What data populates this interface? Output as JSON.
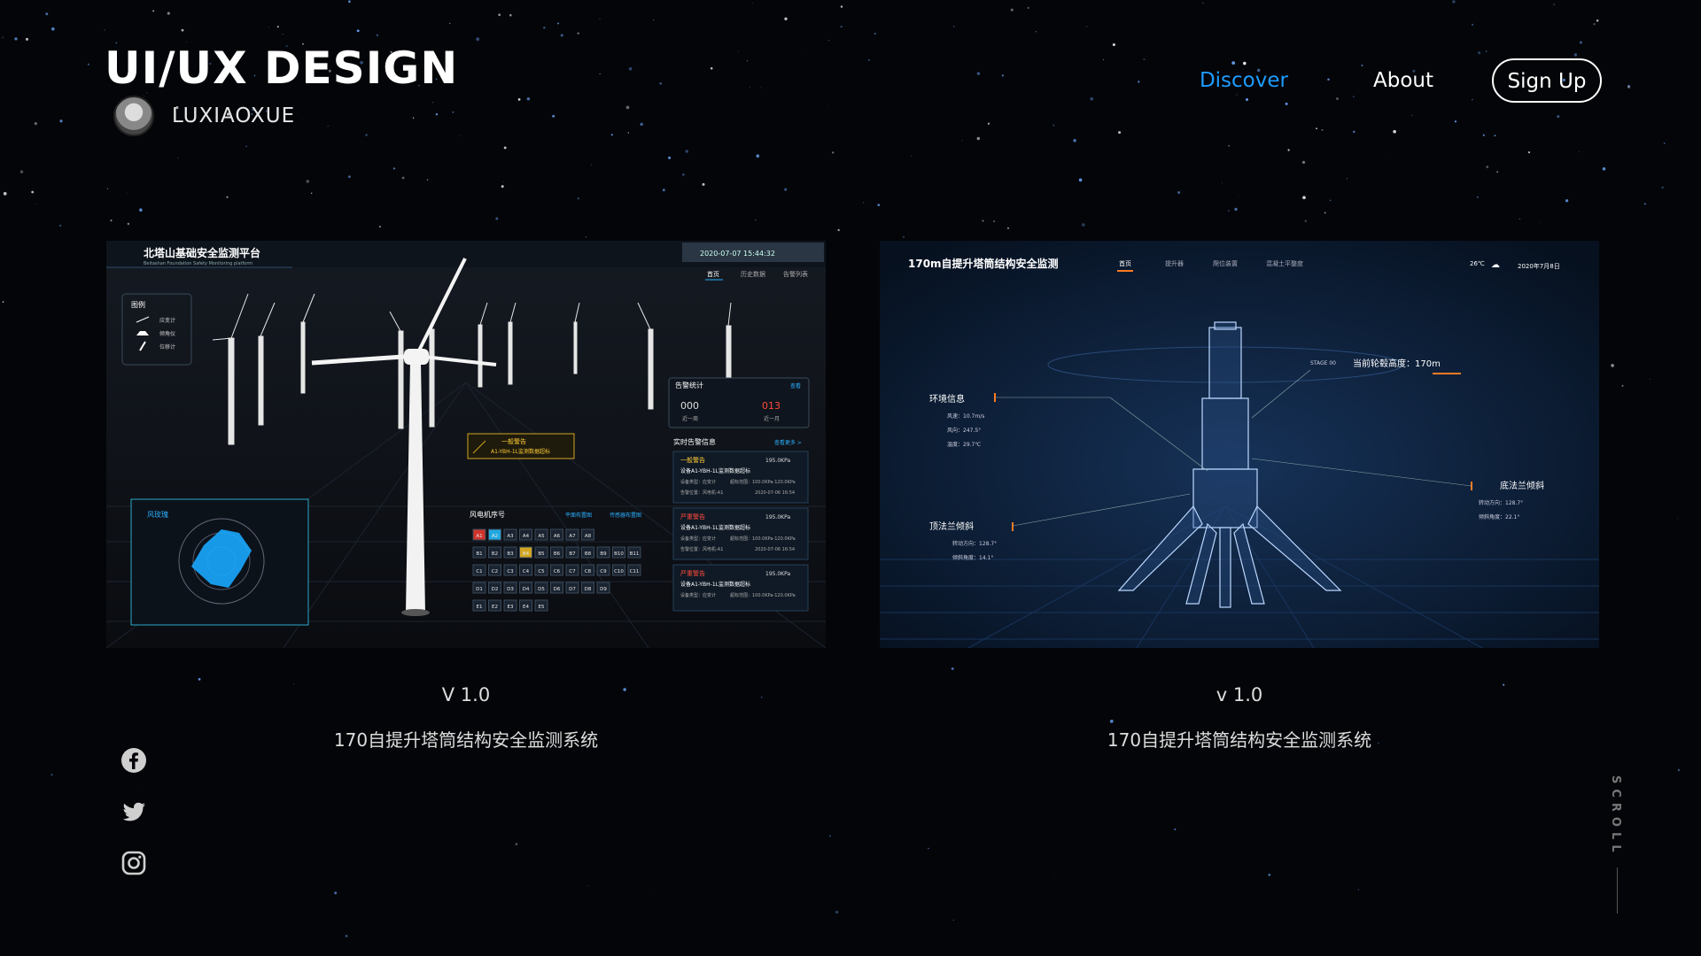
{
  "header": {
    "title": "UI/UX DESIGN",
    "author": "LUXIAOXUE"
  },
  "nav": {
    "discover": "Discover",
    "about": "About",
    "signup": "Sign Up",
    "active_color": "#1e9cff"
  },
  "projects": [
    {
      "version": "V 1.0",
      "name": "170自提升塔筒结构安全监测系统",
      "screen": {
        "title": "北塔山基础安全监测平台",
        "subtitle": "Beitashan Foundation Safety Monitoring platform",
        "datetime": "2020-07-07   15:44:32",
        "tabs": [
          "首页",
          "历史数据",
          "告警列表"
        ],
        "legend_title": "图例",
        "legend_items": [
          "应变计",
          "倾角仪",
          "位移计"
        ],
        "alarm_stats_title": "告警统计",
        "alarm_stats_link": "查看",
        "alarm_week_value": "000",
        "alarm_week_label": "近一周",
        "alarm_month_value": "013",
        "alarm_month_label": "近一月",
        "realtime_title": "实时告警信息",
        "realtime_link": "查看更多 >",
        "callout_title": "一般警告",
        "callout_text": "A1-YBH-1L监测数据超标",
        "alarms": [
          {
            "level": "一般警告",
            "value": "195.0KPa",
            "desc": "设备A1-YBH-1L监测数据超标",
            "type": "设备类型：应变计",
            "range": "超标范围：100.0KPa-120.0KPa",
            "pos": "告警位置：风电机-A1",
            "time": "2020-07-06 16:54"
          },
          {
            "level": "严重警告",
            "value": "195.0KPa",
            "desc": "设备A1-YBH-1L监测数据超标",
            "type": "设备类型：应变计",
            "range": "超标范围：100.0KPa-120.0KPa",
            "pos": "告警位置：风电机-A1",
            "time": "2020-07-06 16:54"
          },
          {
            "level": "严重警告",
            "value": "195.0KPa",
            "desc": "设备A1-YBH-1L监测数据超标",
            "type": "设备类型：应变计",
            "range": "超标范围：100.0KPa-120.0KPa"
          }
        ],
        "wind_rose_title": "风玫瑰",
        "turbine_title": "风电机序号",
        "turbine_link1": "平面布置图",
        "turbine_link2": "传感器布置图",
        "turbine_rows": [
          [
            "A1",
            "A2",
            "A3",
            "A4",
            "A5",
            "A6",
            "A7",
            "A8"
          ],
          [
            "B1",
            "B2",
            "B3",
            "B4",
            "B5",
            "B6",
            "B7",
            "B8",
            "B9",
            "B10",
            "B11"
          ],
          [
            "C1",
            "C2",
            "C3",
            "C4",
            "C5",
            "C6",
            "C7",
            "C8",
            "C9",
            "C10",
            "C11"
          ],
          [
            "D1",
            "D2",
            "D3",
            "D4",
            "D5",
            "D6",
            "D7",
            "D8",
            "D9"
          ],
          [
            "E1",
            "E2",
            "E3",
            "E4",
            "E5"
          ]
        ]
      }
    },
    {
      "version": "v 1.0",
      "name": "170自提升塔筒结构安全监测系统",
      "screen": {
        "title": "170m自提升塔筒结构安全监测",
        "tabs": [
          "首页",
          "提升器",
          "爬位装置",
          "混凝土平整度"
        ],
        "temp": "26℃",
        "date": "2020年7月8日",
        "stage": "STAGE 00",
        "height_label": "当前轮毂高度：170m",
        "env_title": "环境信息",
        "env_items": [
          "风速：10.7m/s",
          "风向：247.5°",
          "温度：29.7℃"
        ],
        "top_title": "顶法兰倾斜",
        "top_items": [
          "转动方向：128.7°",
          "倾斜角度：14.1°"
        ],
        "bottom_title": "底法兰倾斜",
        "bottom_items": [
          "转动方向：128.7°",
          "倾斜角度：22.1°"
        ]
      }
    }
  ],
  "social": [
    "facebook-icon",
    "twitter-icon",
    "instagram-icon"
  ],
  "scroll_label": "SCROLL"
}
